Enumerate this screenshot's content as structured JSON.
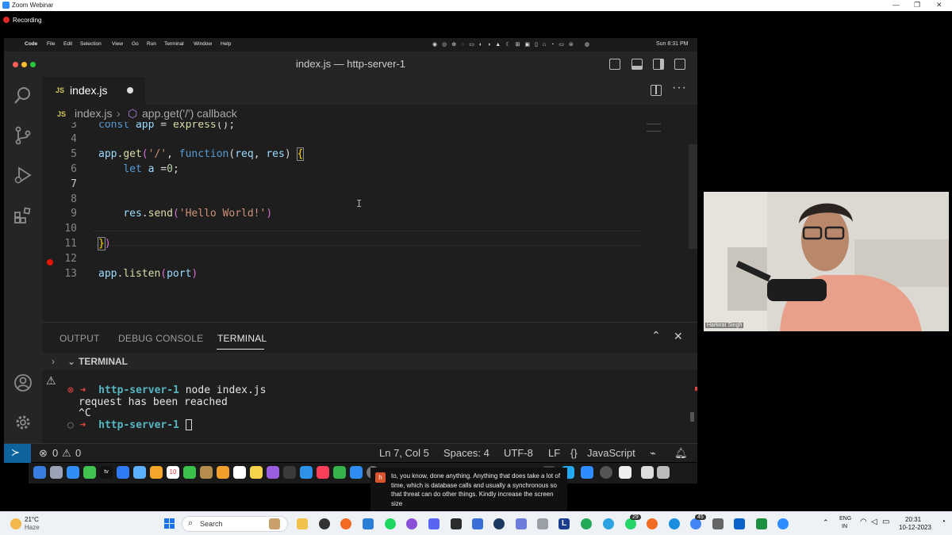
{
  "zoom": {
    "title": "Zoom Webinar",
    "recording_label": "Recording"
  },
  "mac_menubar": {
    "items": [
      "Code",
      "File",
      "Edit",
      "Selection",
      "View",
      "Go",
      "Run",
      "Terminal",
      "Window",
      "Help"
    ],
    "clock": "Sun 8:31 PM"
  },
  "vscode": {
    "window_title": "index.js — http-server-1",
    "tab": {
      "icon": "JS",
      "label": "index.js"
    },
    "breadcrumb": {
      "file": "index.js",
      "symbol": "app.get('/') callback"
    },
    "code_lines": [
      {
        "n": "3",
        "text": "const app = express();"
      },
      {
        "n": "4",
        "text": ""
      },
      {
        "n": "5",
        "text": "app.get('/', function(req, res) {"
      },
      {
        "n": "6",
        "text": "    let a =0;"
      },
      {
        "n": "7",
        "text": ""
      },
      {
        "n": "8",
        "text": ""
      },
      {
        "n": "9",
        "text": "    res.send('Hello World!')"
      },
      {
        "n": "10",
        "text": ""
      },
      {
        "n": "11",
        "text": "})"
      },
      {
        "n": "12",
        "text": ""
      },
      {
        "n": "13",
        "text": "app.listen(port)"
      }
    ],
    "panel_tabs": [
      "OUTPUT",
      "DEBUG CONSOLE",
      "TERMINAL"
    ],
    "terminal_header": "TERMINAL",
    "terminal": {
      "dir": "http-server-1",
      "cmd": "node index.js",
      "out1": "request has been reached",
      "out2": "^C",
      "dir2": "http-server-1"
    },
    "status": {
      "errors": "0",
      "warnings": "0",
      "position": "Ln 7, Col 5",
      "spaces": "Spaces: 4",
      "encoding": "UTF-8",
      "eol": "LF",
      "language": "JavaScript"
    }
  },
  "caption": {
    "initial": "h",
    "text": "to, you know, done anything. Anything that does take a lot of time, which is database calls and usually a synchronous so that threat can do other things. Kindly increase the screen size"
  },
  "webcam": {
    "name": "Harkirat Singh"
  },
  "taskbar": {
    "weather_temp": "21°C",
    "weather_desc": "Haze",
    "search_label": "Search",
    "lang1": "ENG",
    "lang2": "IN",
    "time": "20:31",
    "date": "10-12-2023",
    "badge_whatsapp": "29",
    "badge_chrome": "45"
  },
  "colors": {
    "accent": "#0e639c",
    "statusbar": "#1e1e1e",
    "editor_bg": "#1e1e1e"
  }
}
